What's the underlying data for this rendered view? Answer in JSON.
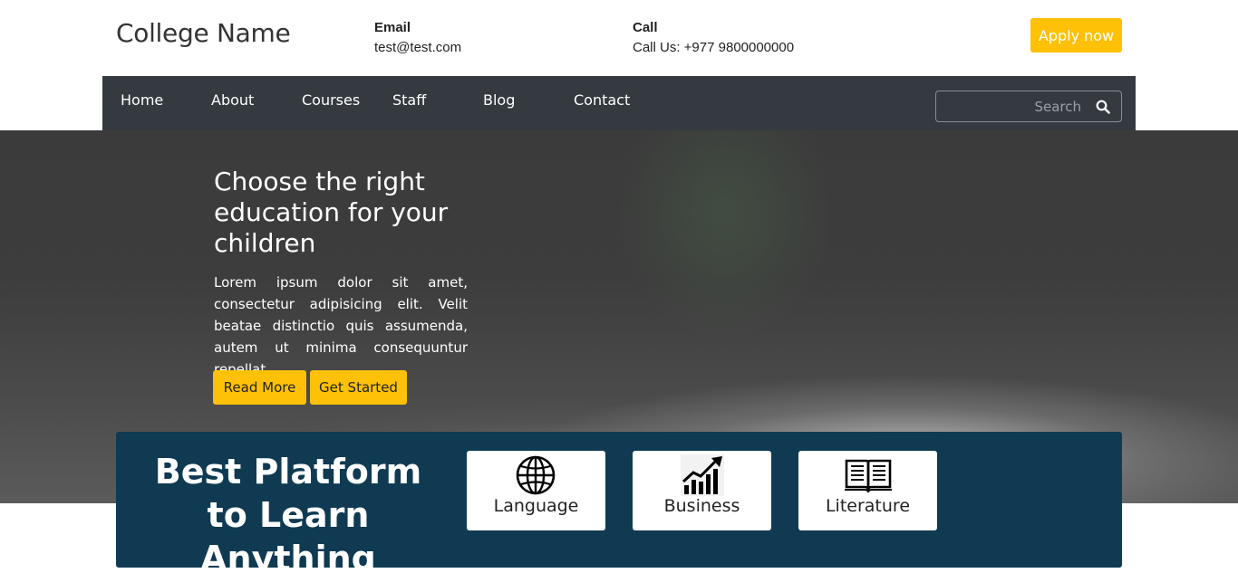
{
  "header": {
    "college_name": "College Name",
    "email_label": "Email",
    "email_value": "test@test.com",
    "call_label": "Call",
    "call_value": "Call Us: +977 9800000000",
    "apply_label": "Apply now"
  },
  "nav": {
    "items": [
      "Home",
      "About",
      "Courses",
      "Staff",
      "Blog",
      "Contact"
    ],
    "search_placeholder": "Search"
  },
  "hero": {
    "title": "Choose the right education for your children",
    "text": "Lorem ipsum dolor sit amet, consectetur adipisicing elit. Velit beatae distinctio quis assumenda, autem ut minima consequuntur repellat.",
    "read_more": "Read More",
    "get_started": "Get Started"
  },
  "platform": {
    "title": "Best Platform to Learn Anything",
    "categories": [
      {
        "label": "Language",
        "icon": "globe-icon"
      },
      {
        "label": "Business",
        "icon": "growth-chart-icon"
      },
      {
        "label": "Literature",
        "icon": "open-book-icon"
      }
    ]
  },
  "colors": {
    "accent": "#ffc107",
    "nav_bg": "#343a40",
    "panel_bg": "#0f3a52"
  }
}
